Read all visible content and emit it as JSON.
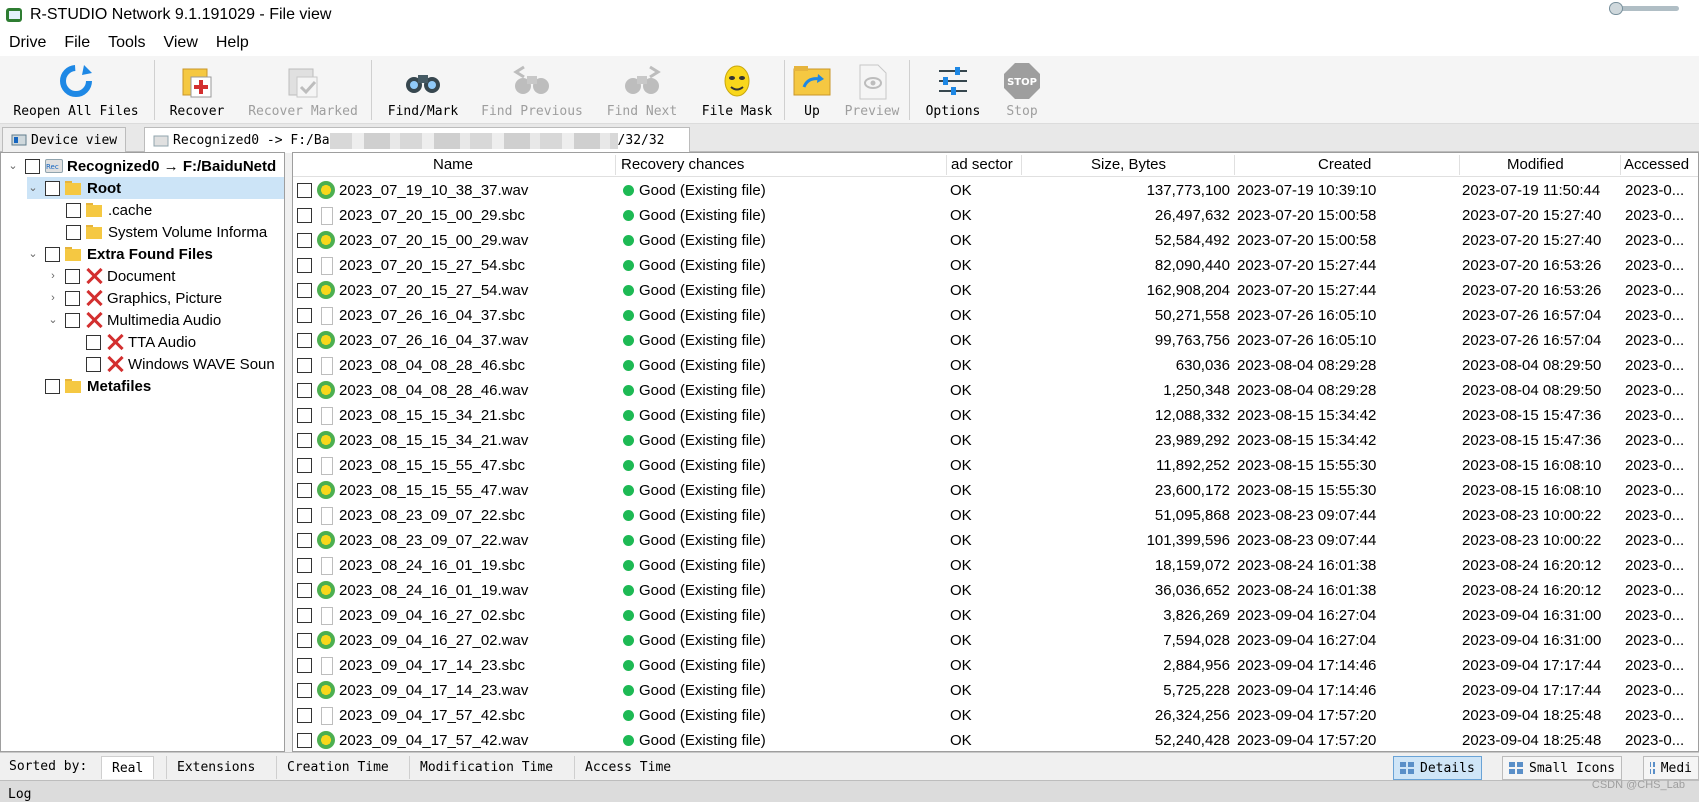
{
  "window": {
    "title": "R-STUDIO Network 9.1.191029 - File view"
  },
  "menu": [
    "Drive",
    "File",
    "Tools",
    "View",
    "Help"
  ],
  "toolbar": {
    "reopen": "Reopen All Files",
    "recover": "Recover",
    "recover_marked": "Recover Marked",
    "find_mark": "Find/Mark",
    "find_previous": "Find Previous",
    "find_next": "Find Next",
    "file_mask": "File Mask",
    "up": "Up",
    "preview": "Preview",
    "options": "Options",
    "stop": "Stop"
  },
  "tabs": {
    "device_view": "Device view",
    "file_view_prefix": "Recognized0 -> F:/Ba",
    "file_view_suffix": "/32/32",
    "rec_badge": "Rec"
  },
  "tree": {
    "root_node": "Recognized0 → F:/BaiduNetd",
    "root": "Root",
    "cache": ".cache",
    "system_volume": "System Volume Informa",
    "extra_found": "Extra Found Files",
    "document": "Document",
    "graphics": "Graphics, Picture",
    "multimedia": "Multimedia Audio",
    "tta": "TTA Audio",
    "wave": "Windows WAVE Soun",
    "metafiles": "Metafiles"
  },
  "columns": {
    "name": "Name",
    "recovery": "Recovery chances",
    "bad_sectors": "ad sector",
    "size": "Size, Bytes",
    "created": "Created",
    "modified": "Modified",
    "accessed": "Accessed"
  },
  "files": [
    {
      "name": "2023_07_19_10_38_37.wav",
      "type": "wav",
      "recovery": "Good (Existing file)",
      "bad": "OK",
      "size": "137,773,100",
      "created": "2023-07-19 10:39:10",
      "modified": "2023-07-19 11:50:44",
      "accessed": "2023-0..."
    },
    {
      "name": "2023_07_20_15_00_29.sbc",
      "type": "sbc",
      "recovery": "Good (Existing file)",
      "bad": "OK",
      "size": "26,497,632",
      "created": "2023-07-20 15:00:58",
      "modified": "2023-07-20 15:27:40",
      "accessed": "2023-0..."
    },
    {
      "name": "2023_07_20_15_00_29.wav",
      "type": "wav",
      "recovery": "Good (Existing file)",
      "bad": "OK",
      "size": "52,584,492",
      "created": "2023-07-20 15:00:58",
      "modified": "2023-07-20 15:27:40",
      "accessed": "2023-0..."
    },
    {
      "name": "2023_07_20_15_27_54.sbc",
      "type": "sbc",
      "recovery": "Good (Existing file)",
      "bad": "OK",
      "size": "82,090,440",
      "created": "2023-07-20 15:27:44",
      "modified": "2023-07-20 16:53:26",
      "accessed": "2023-0..."
    },
    {
      "name": "2023_07_20_15_27_54.wav",
      "type": "wav",
      "recovery": "Good (Existing file)",
      "bad": "OK",
      "size": "162,908,204",
      "created": "2023-07-20 15:27:44",
      "modified": "2023-07-20 16:53:26",
      "accessed": "2023-0..."
    },
    {
      "name": "2023_07_26_16_04_37.sbc",
      "type": "sbc",
      "recovery": "Good (Existing file)",
      "bad": "OK",
      "size": "50,271,558",
      "created": "2023-07-26 16:05:10",
      "modified": "2023-07-26 16:57:04",
      "accessed": "2023-0..."
    },
    {
      "name": "2023_07_26_16_04_37.wav",
      "type": "wav",
      "recovery": "Good (Existing file)",
      "bad": "OK",
      "size": "99,763,756",
      "created": "2023-07-26 16:05:10",
      "modified": "2023-07-26 16:57:04",
      "accessed": "2023-0..."
    },
    {
      "name": "2023_08_04_08_28_46.sbc",
      "type": "sbc",
      "recovery": "Good (Existing file)",
      "bad": "OK",
      "size": "630,036",
      "created": "2023-08-04 08:29:28",
      "modified": "2023-08-04 08:29:50",
      "accessed": "2023-0..."
    },
    {
      "name": "2023_08_04_08_28_46.wav",
      "type": "wav",
      "recovery": "Good (Existing file)",
      "bad": "OK",
      "size": "1,250,348",
      "created": "2023-08-04 08:29:28",
      "modified": "2023-08-04 08:29:50",
      "accessed": "2023-0..."
    },
    {
      "name": "2023_08_15_15_34_21.sbc",
      "type": "sbc",
      "recovery": "Good (Existing file)",
      "bad": "OK",
      "size": "12,088,332",
      "created": "2023-08-15 15:34:42",
      "modified": "2023-08-15 15:47:36",
      "accessed": "2023-0..."
    },
    {
      "name": "2023_08_15_15_34_21.wav",
      "type": "wav",
      "recovery": "Good (Existing file)",
      "bad": "OK",
      "size": "23,989,292",
      "created": "2023-08-15 15:34:42",
      "modified": "2023-08-15 15:47:36",
      "accessed": "2023-0..."
    },
    {
      "name": "2023_08_15_15_55_47.sbc",
      "type": "sbc",
      "recovery": "Good (Existing file)",
      "bad": "OK",
      "size": "11,892,252",
      "created": "2023-08-15 15:55:30",
      "modified": "2023-08-15 16:08:10",
      "accessed": "2023-0..."
    },
    {
      "name": "2023_08_15_15_55_47.wav",
      "type": "wav",
      "recovery": "Good (Existing file)",
      "bad": "OK",
      "size": "23,600,172",
      "created": "2023-08-15 15:55:30",
      "modified": "2023-08-15 16:08:10",
      "accessed": "2023-0..."
    },
    {
      "name": "2023_08_23_09_07_22.sbc",
      "type": "sbc",
      "recovery": "Good (Existing file)",
      "bad": "OK",
      "size": "51,095,868",
      "created": "2023-08-23 09:07:44",
      "modified": "2023-08-23 10:00:22",
      "accessed": "2023-0..."
    },
    {
      "name": "2023_08_23_09_07_22.wav",
      "type": "wav",
      "recovery": "Good (Existing file)",
      "bad": "OK",
      "size": "101,399,596",
      "created": "2023-08-23 09:07:44",
      "modified": "2023-08-23 10:00:22",
      "accessed": "2023-0..."
    },
    {
      "name": "2023_08_24_16_01_19.sbc",
      "type": "sbc",
      "recovery": "Good (Existing file)",
      "bad": "OK",
      "size": "18,159,072",
      "created": "2023-08-24 16:01:38",
      "modified": "2023-08-24 16:20:12",
      "accessed": "2023-0..."
    },
    {
      "name": "2023_08_24_16_01_19.wav",
      "type": "wav",
      "recovery": "Good (Existing file)",
      "bad": "OK",
      "size": "36,036,652",
      "created": "2023-08-24 16:01:38",
      "modified": "2023-08-24 16:20:12",
      "accessed": "2023-0..."
    },
    {
      "name": "2023_09_04_16_27_02.sbc",
      "type": "sbc",
      "recovery": "Good (Existing file)",
      "bad": "OK",
      "size": "3,826,269",
      "created": "2023-09-04 16:27:04",
      "modified": "2023-09-04 16:31:00",
      "accessed": "2023-0..."
    },
    {
      "name": "2023_09_04_16_27_02.wav",
      "type": "wav",
      "recovery": "Good (Existing file)",
      "bad": "OK",
      "size": "7,594,028",
      "created": "2023-09-04 16:27:04",
      "modified": "2023-09-04 16:31:00",
      "accessed": "2023-0..."
    },
    {
      "name": "2023_09_04_17_14_23.sbc",
      "type": "sbc",
      "recovery": "Good (Existing file)",
      "bad": "OK",
      "size": "2,884,956",
      "created": "2023-09-04 17:14:46",
      "modified": "2023-09-04 17:17:44",
      "accessed": "2023-0..."
    },
    {
      "name": "2023_09_04_17_14_23.wav",
      "type": "wav",
      "recovery": "Good (Existing file)",
      "bad": "OK",
      "size": "5,725,228",
      "created": "2023-09-04 17:14:46",
      "modified": "2023-09-04 17:17:44",
      "accessed": "2023-0..."
    },
    {
      "name": "2023_09_04_17_57_42.sbc",
      "type": "sbc",
      "recovery": "Good (Existing file)",
      "bad": "OK",
      "size": "26,324,256",
      "created": "2023-09-04 17:57:20",
      "modified": "2023-09-04 18:25:48",
      "accessed": "2023-0..."
    },
    {
      "name": "2023_09_04_17_57_42.wav",
      "type": "wav",
      "recovery": "Good (Existing file)",
      "bad": "OK",
      "size": "52,240,428",
      "created": "2023-09-04 17:57:20",
      "modified": "2023-09-04 18:25:48",
      "accessed": "2023-0..."
    }
  ],
  "status": {
    "sorted_by": "Sorted by:",
    "sort_tabs": [
      "Real",
      "Extensions",
      "Creation Time",
      "Modification Time",
      "Access Time"
    ],
    "view_details": "Details",
    "view_small_icons": "Small Icons",
    "view_medium": "Medi",
    "log": "Log"
  },
  "watermark": "CSDN @CHS_Lab",
  "colors": {
    "good": "#1db954",
    "selection": "#cce4f7",
    "disabled_text": "#9e9e9e"
  }
}
